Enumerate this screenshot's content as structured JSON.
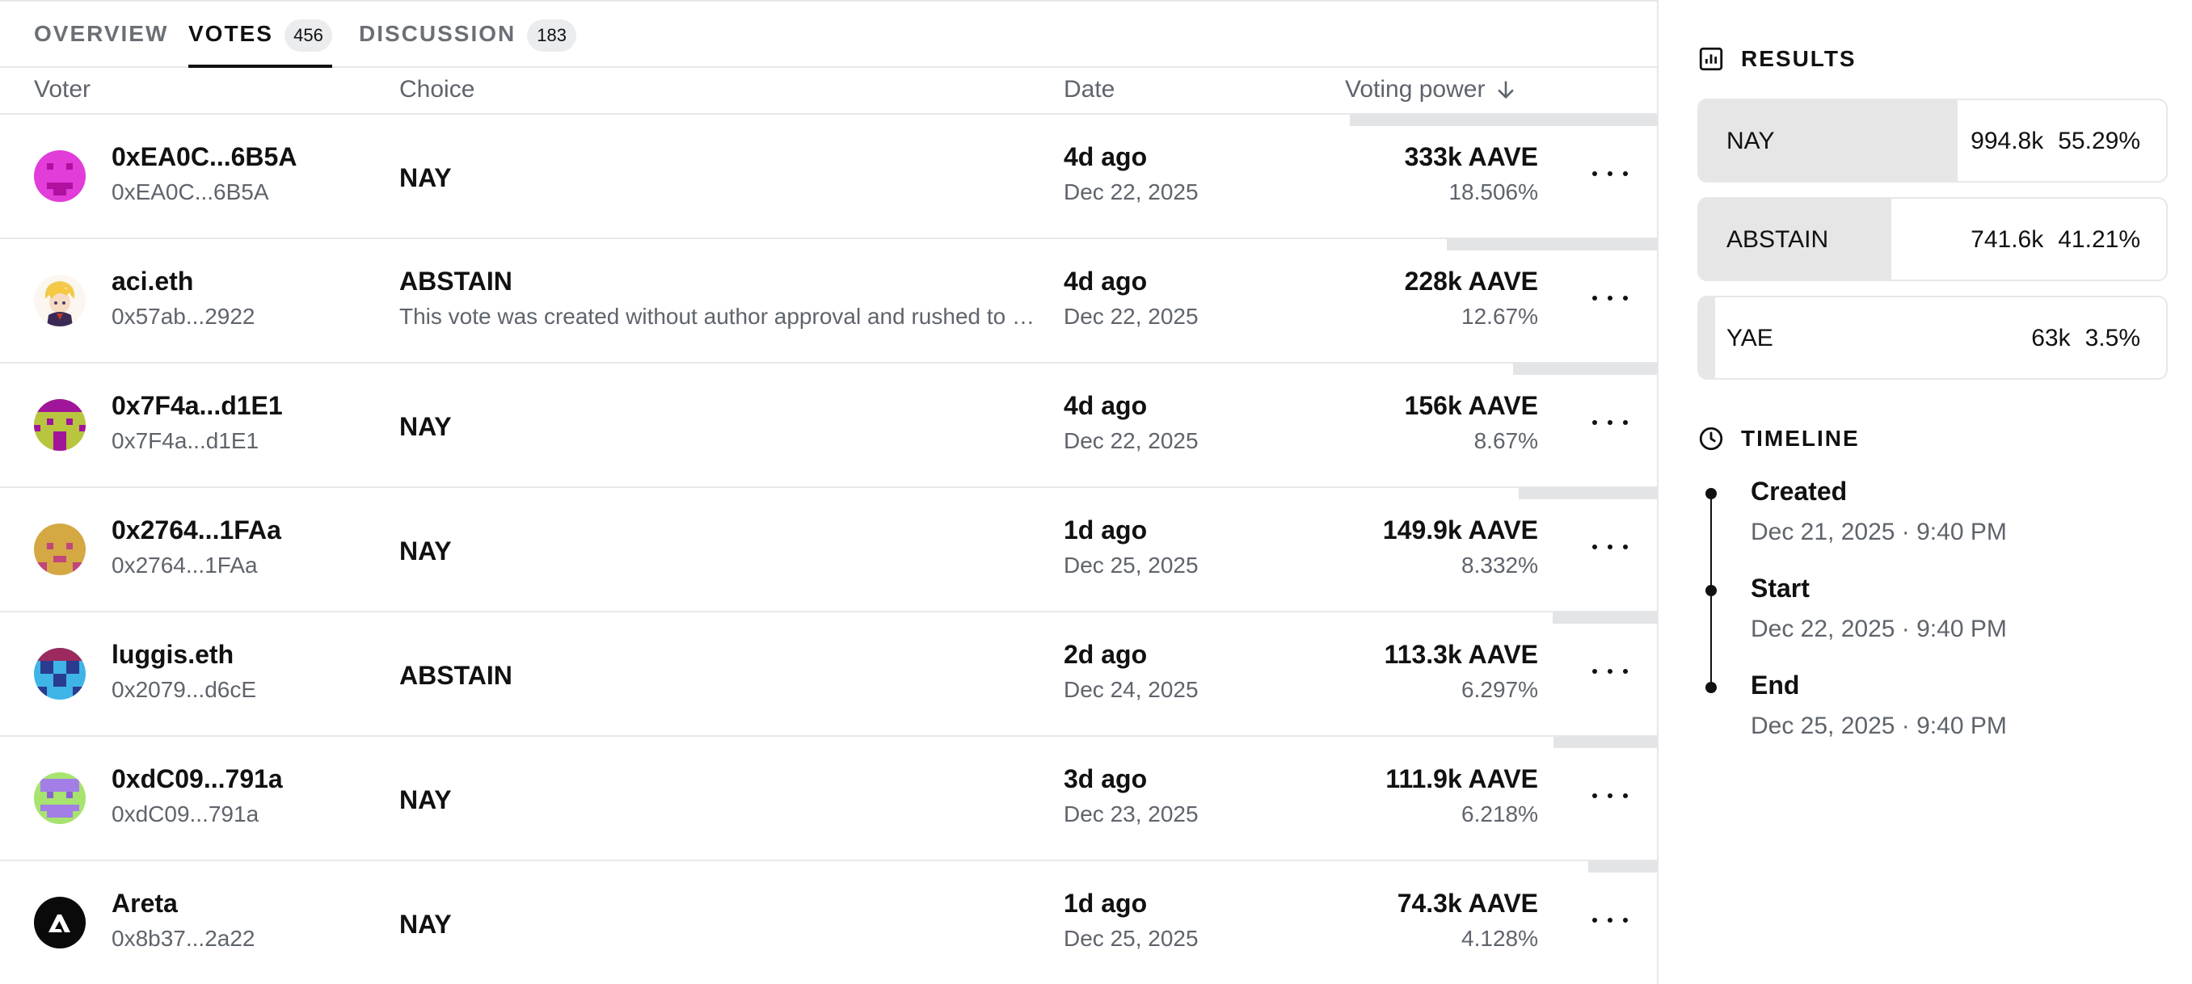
{
  "tabs": [
    {
      "label": "OVERVIEW"
    },
    {
      "label": "VOTES",
      "count": "456"
    },
    {
      "label": "DISCUSSION",
      "count": "183"
    }
  ],
  "table": {
    "headers": {
      "voter": "Voter",
      "choice": "Choice",
      "date": "Date",
      "power": "Voting power"
    },
    "sort_icon": "arrow-down-icon",
    "rows": [
      {
        "name": "0xEA0C...6B5A",
        "address": "0xEA0C...6B5A",
        "choice": "NAY",
        "reason": "",
        "date_relative": "4d ago",
        "date": "Dec 22, 2025",
        "power": "333k AAVE",
        "percent": "18.506%",
        "power_share": 0.18506
      },
      {
        "name": "aci.eth",
        "address": "0x57ab...2922",
        "choice": "ABSTAIN",
        "reason": "This vote was created without author approval and rushed to snapshot",
        "date_relative": "4d ago",
        "date": "Dec 22, 2025",
        "power": "228k AAVE",
        "percent": "12.67%",
        "power_share": 0.1267
      },
      {
        "name": "0x7F4a...d1E1",
        "address": "0x7F4a...d1E1",
        "choice": "NAY",
        "reason": "",
        "date_relative": "4d ago",
        "date": "Dec 22, 2025",
        "power": "156k AAVE",
        "percent": "8.67%",
        "power_share": 0.0867
      },
      {
        "name": "0x2764...1FAa",
        "address": "0x2764...1FAa",
        "choice": "NAY",
        "reason": "",
        "date_relative": "1d ago",
        "date": "Dec 25, 2025",
        "power": "149.9k AAVE",
        "percent": "8.332%",
        "power_share": 0.08332
      },
      {
        "name": "luggis.eth",
        "address": "0x2079...d6cE",
        "choice": "ABSTAIN",
        "reason": "",
        "date_relative": "2d ago",
        "date": "Dec 24, 2025",
        "power": "113.3k AAVE",
        "percent": "6.297%",
        "power_share": 0.06297
      },
      {
        "name": "0xdC09...791a",
        "address": "0xdC09...791a",
        "choice": "NAY",
        "reason": "",
        "date_relative": "3d ago",
        "date": "Dec 23, 2025",
        "power": "111.9k AAVE",
        "percent": "6.218%",
        "power_share": 0.06218
      },
      {
        "name": "Areta",
        "address": "0x8b37...2a22",
        "choice": "NAY",
        "reason": "",
        "date_relative": "1d ago",
        "date": "Dec 25, 2025",
        "power": "74.3k AAVE",
        "percent": "4.128%",
        "power_share": 0.04128
      }
    ]
  },
  "results": {
    "title": "RESULTS",
    "icon": "bar-chart-icon",
    "items": [
      {
        "label": "NAY",
        "votes": "994.8k",
        "percent": "55.29%",
        "share": 0.5529
      },
      {
        "label": "ABSTAIN",
        "votes": "741.6k",
        "percent": "41.21%",
        "share": 0.4121
      },
      {
        "label": "YAE",
        "votes": "63k",
        "percent": "3.5%",
        "share": 0.035
      }
    ]
  },
  "timeline": {
    "title": "TIMELINE",
    "icon": "clock-icon",
    "items": [
      {
        "label": "Created",
        "date": "Dec 21, 2025 · 9:40 PM"
      },
      {
        "label": "Start",
        "date": "Dec 22, 2025 · 9:40 PM"
      },
      {
        "label": "End",
        "date": "Dec 25, 2025 · 9:40 PM"
      }
    ]
  },
  "colors": {
    "bar": "#e3e4e6",
    "result_fill": "#e6e6e6",
    "muted": "#5f646c"
  }
}
